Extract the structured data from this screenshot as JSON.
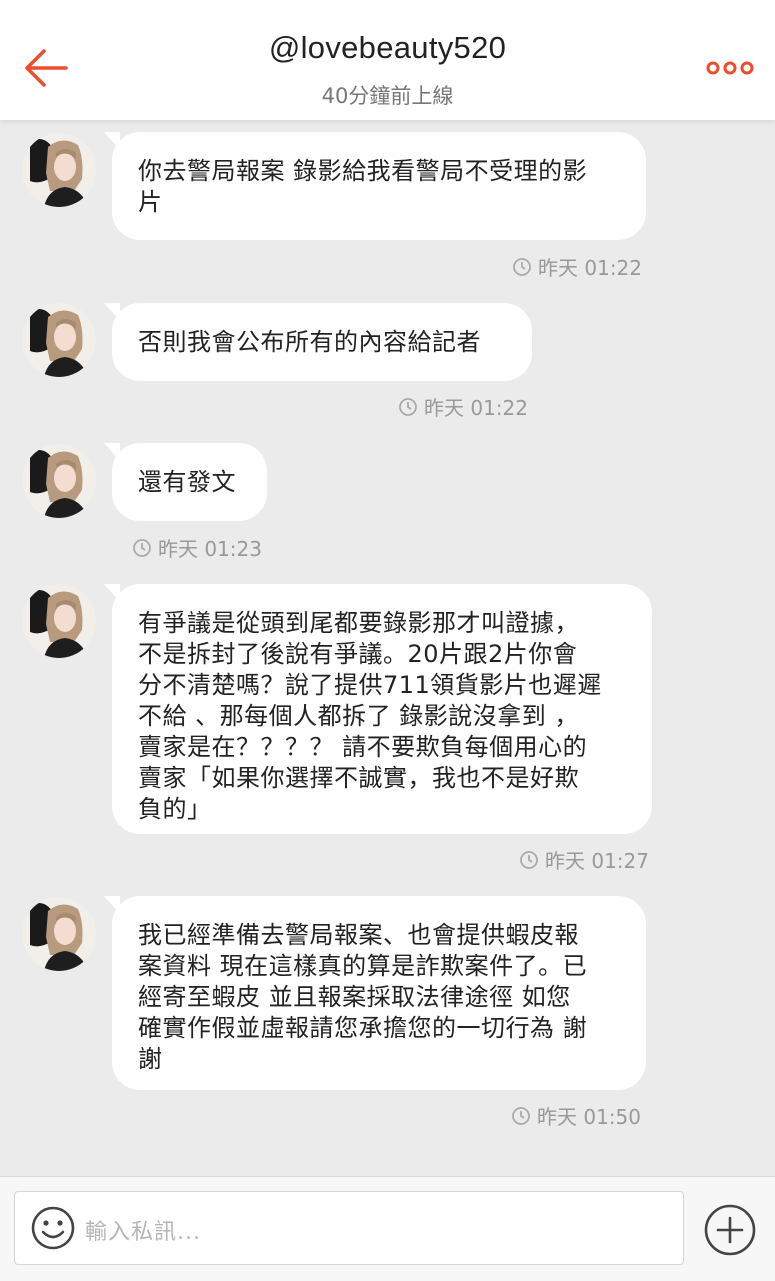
{
  "header": {
    "title": "@lovebeauty520",
    "status": "40分鐘前上線"
  },
  "messages": [
    {
      "lines": [
        "你去警局報案 錄影給我看警局不受理的影",
        "片"
      ],
      "time": "昨天 01:22"
    },
    {
      "lines": [
        "否則我會公布所有的內容給記者"
      ],
      "time": "昨天 01:22"
    },
    {
      "lines": [
        "還有發文"
      ],
      "time": "昨天 01:23"
    },
    {
      "lines": [
        "有爭議是從頭到尾都要錄影那才叫證據，",
        "不是拆封了後說有爭議。20片跟2片你會",
        "分不清楚嗎？說了提供711領貨影片也遲遲",
        "不給 、那每個人都拆了 錄影說沒拿到 ，",
        "賣家是在？？？？ 請不要欺負每個用心的",
        "賣家「如果你選擇不誠實，我也不是好欺",
        "負的」"
      ],
      "time": "昨天 01:27"
    },
    {
      "lines": [
        "我已經準備去警局報案、也會提供蝦皮報",
        "案資料 現在這樣真的算是詐欺案件了。已",
        "經寄至蝦皮 並且報案採取法律途徑 如您",
        "確實作假並虛報請您承擔您的一切行為 謝",
        "謝"
      ],
      "time": "昨天 01:50"
    }
  ],
  "composer": {
    "placeholder": "輸入私訊..."
  },
  "icons": {
    "back": "back-arrow-icon",
    "more": "more-dots-icon",
    "clock": "clock-icon",
    "emoji": "smiley-icon",
    "add": "plus-circle-icon"
  },
  "colors": {
    "accent": "#ee4d2d",
    "background": "#ebebeb",
    "bubble": "#ffffff",
    "timestamp": "#999999"
  }
}
